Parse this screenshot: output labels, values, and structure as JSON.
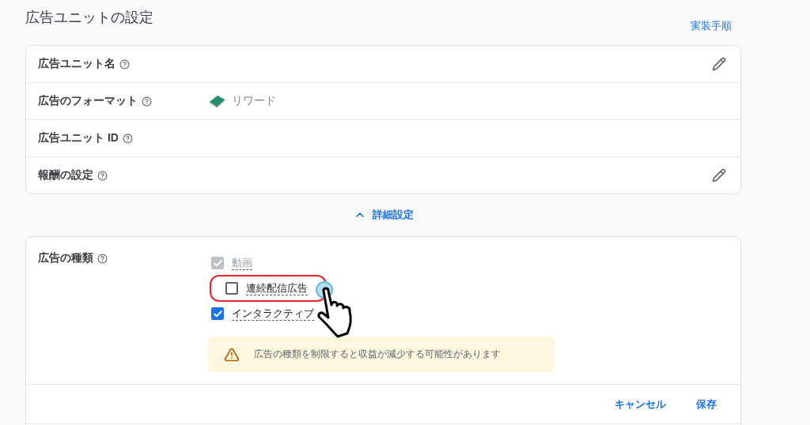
{
  "title": "広告ユニットの設定",
  "link": "実装手順",
  "rows": [
    {
      "label": "広告ユニット名",
      "editable": true
    },
    {
      "label": "広告のフォーマット",
      "editable": false,
      "value": "リワード"
    },
    {
      "label": "広告ユニット ID",
      "editable": false
    },
    {
      "label": "報酬の設定",
      "editable": true
    }
  ],
  "advanced": {
    "label": "詳細設定",
    "expanded": true
  },
  "ad_types": {
    "label": "広告の種類",
    "options": [
      {
        "label": "動画",
        "checked": true,
        "disabled": true,
        "highlighted": false
      },
      {
        "label": "連続配信広告",
        "checked": false,
        "disabled": false,
        "highlighted": true
      },
      {
        "label": "インタラクティブ",
        "checked": true,
        "disabled": false,
        "highlighted": false
      }
    ],
    "warning": "広告の種類を制限すると収益が減少する可能性があります"
  },
  "buttons": [
    "キャンセル",
    "保存"
  ]
}
